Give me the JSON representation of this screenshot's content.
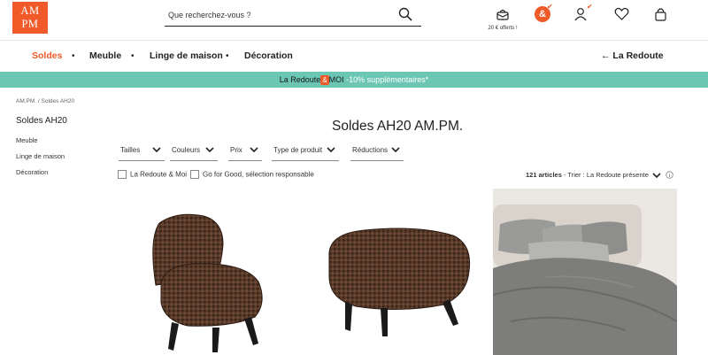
{
  "brand": {
    "logo_line1": "AM",
    "logo_line2": "PM",
    "color": "#f05a28"
  },
  "header": {
    "search_placeholder": "Que recherchez-vous ?",
    "offers_label": "20 € offerts !",
    "club_badge": "&"
  },
  "nav": {
    "items": [
      "Soldes",
      "Meuble",
      "Linge de maison",
      "Décoration"
    ],
    "active": "Soldes",
    "back_label": "La Redoute"
  },
  "promo": {
    "brand_left": "La Redoute",
    "amp": "&",
    "brand_right": "MOI",
    "offer": "-10% supplémentaires*",
    "background": "#6bc6b3"
  },
  "breadcrumb": "AM.PM.  /  Soldes AH20",
  "sidebar": {
    "title": "Soldes AH20",
    "links": [
      "Meuble",
      "Linge de maison",
      "Décoration"
    ]
  },
  "main": {
    "title": "Soldes AH20 AM.PM.",
    "filters": [
      "Tailles",
      "Couleurs",
      "Prix",
      "Type de produit",
      "Réductions"
    ],
    "checkboxes": [
      "La Redoute & Moi",
      "Go for Good, sélection responsable"
    ],
    "count_text": "121 articles",
    "sort_prefix": "- Trier :",
    "sort_value": "La Redoute présente"
  },
  "products": [
    {
      "name": "houndstooth-armchair"
    },
    {
      "name": "houndstooth-footstool"
    },
    {
      "name": "grey-linen-bedding"
    }
  ]
}
